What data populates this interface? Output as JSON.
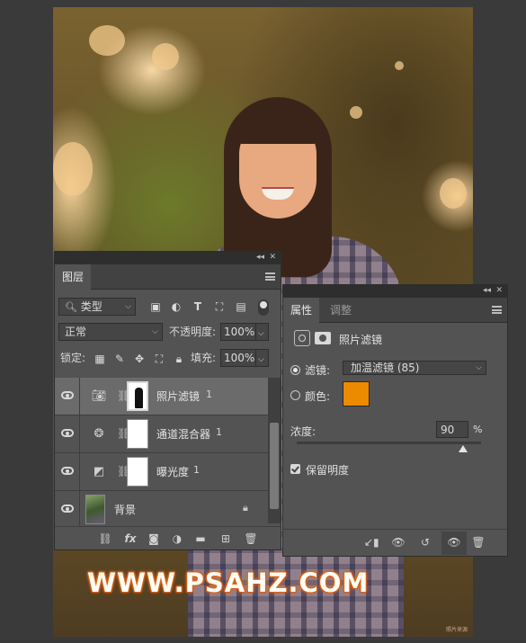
{
  "canvas": {
    "watermark": "WWW.PSAHZ.COM",
    "small_credit": "照片来源"
  },
  "layers_panel": {
    "tab_layers": "图层",
    "filter_kind": "类型",
    "blend_mode": "正常",
    "opacity_label": "不透明度:",
    "opacity_value": "100%",
    "lock_label": "锁定:",
    "fill_label": "填充:",
    "fill_value": "100%",
    "layers": [
      {
        "name": "照片滤镜",
        "number": "1",
        "icon": "camera-filter-icon",
        "selected": true
      },
      {
        "name": "通道混合器",
        "number": "1",
        "icon": "channel-mixer-icon",
        "selected": false
      },
      {
        "name": "曝光度",
        "number": "1",
        "icon": "exposure-icon",
        "selected": false
      },
      {
        "name": "背景",
        "number": "",
        "icon": "photo-thumbnail",
        "selected": false
      }
    ]
  },
  "properties_panel": {
    "tab_properties": "属性",
    "tab_adjustments": "调整",
    "title": "照片滤镜",
    "filter_label": "滤镜:",
    "filter_value": "加温滤镜 (85)",
    "color_label": "颜色:",
    "color_hex": "#ec8a00",
    "density_label": "浓度:",
    "density_value": "90",
    "density_unit": "%",
    "preserve_luminosity_label": "保留明度",
    "preserve_luminosity_checked": true
  }
}
